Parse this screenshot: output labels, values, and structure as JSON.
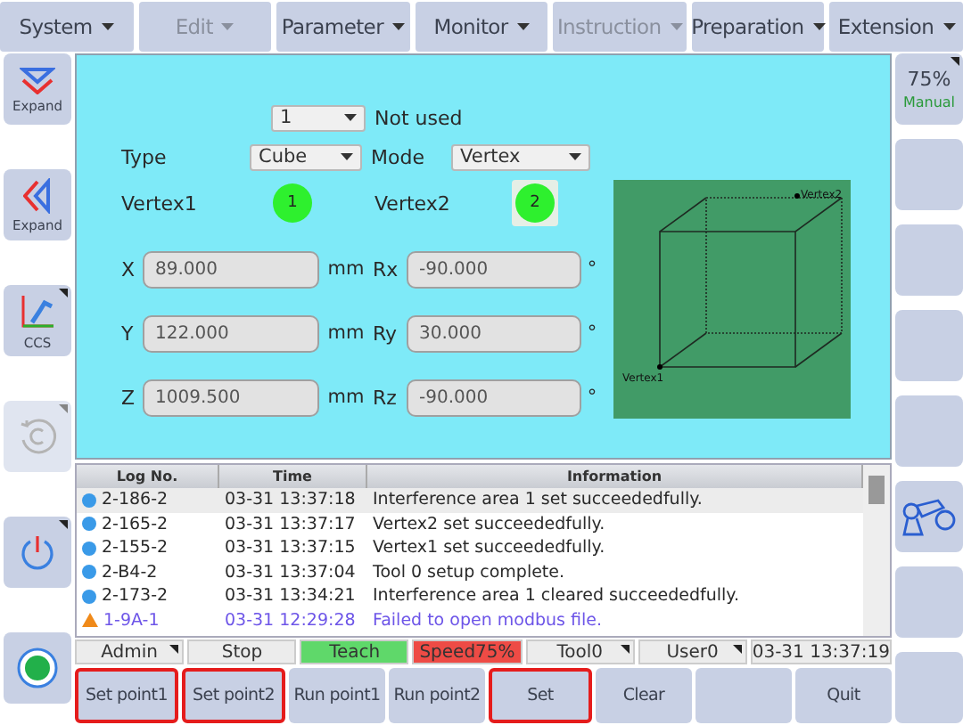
{
  "menu": [
    {
      "label": "System",
      "disabled": false
    },
    {
      "label": "Edit",
      "disabled": true
    },
    {
      "label": "Parameter",
      "disabled": false
    },
    {
      "label": "Monitor",
      "disabled": false
    },
    {
      "label": "Instruction",
      "disabled": true
    },
    {
      "label": "Preparation",
      "disabled": false
    },
    {
      "label": "Extension",
      "disabled": false
    }
  ],
  "left_buttons": [
    {
      "kind": "expand_down",
      "label": "Expand",
      "has_menu": false,
      "disabled": false
    },
    {
      "kind": "expand_left",
      "label": "Expand",
      "has_menu": false,
      "disabled": false
    },
    {
      "kind": "ccs",
      "label": "CCS",
      "has_menu": true,
      "disabled": false
    },
    {
      "kind": "rotate",
      "has_menu": true,
      "disabled": true
    },
    {
      "kind": "power",
      "has_menu": true,
      "disabled": false
    },
    {
      "kind": "record",
      "has_menu": false,
      "disabled": false
    }
  ],
  "right_buttons": [
    {
      "kind": "speed",
      "value": "75%",
      "mode": "Manual",
      "has_menu": true
    },
    {
      "kind": "blank"
    },
    {
      "kind": "blank"
    },
    {
      "kind": "blank"
    },
    {
      "kind": "blank"
    },
    {
      "kind": "robot"
    },
    {
      "kind": "blank"
    },
    {
      "kind": "blank"
    }
  ],
  "area": {
    "index": "1",
    "status": "Not used",
    "type_label": "Type",
    "type": "Cube",
    "mode_label": "Mode",
    "mode": "Vertex",
    "vertices": [
      {
        "label": "Vertex1",
        "number": "1",
        "selected": false
      },
      {
        "label": "Vertex2",
        "number": "2",
        "selected": true
      }
    ],
    "coords": [
      {
        "label": "X",
        "value": "89.000",
        "unit": "mm",
        "rot_label": "Rx",
        "rot_value": "-90.000",
        "rot_unit": "°"
      },
      {
        "label": "Y",
        "value": "122.000",
        "unit": "mm",
        "rot_label": "Ry",
        "rot_value": "30.000",
        "rot_unit": "°"
      },
      {
        "label": "Z",
        "value": "1009.500",
        "unit": "mm",
        "rot_label": "Rz",
        "rot_value": "-90.000",
        "rot_unit": "°"
      }
    ],
    "diagram": {
      "top_label": "Vertex2",
      "bottom_label": "Vertex1"
    }
  },
  "log": {
    "columns": [
      "Log No.",
      "Time",
      "Information"
    ],
    "rows": [
      {
        "kind": "info",
        "no": "2-186-2",
        "time": "03-31 13:37:18",
        "info": "Interference area 1 set succeededfully.",
        "selected": true
      },
      {
        "kind": "info",
        "no": "2-165-2",
        "time": "03-31 13:37:17",
        "info": "Vertex2 set succeededfully.",
        "selected": false
      },
      {
        "kind": "info",
        "no": "2-155-2",
        "time": "03-31 13:37:15",
        "info": "Vertex1 set succeededfully.",
        "selected": false
      },
      {
        "kind": "info",
        "no": "2-B4-2",
        "time": "03-31 13:37:04",
        "info": "Tool 0 setup complete.",
        "selected": false
      },
      {
        "kind": "info",
        "no": "2-173-2",
        "time": "03-31 13:34:21",
        "info": "Interference area 1  cleared succeededfully.",
        "selected": false
      },
      {
        "kind": "warning",
        "no": "1-9A-1",
        "time": "03-31 12:29:28",
        "info": "Failed to open modbus file.",
        "selected": false
      }
    ]
  },
  "status_bar": [
    {
      "label": "Admin",
      "color": "#ececec",
      "has_menu": true
    },
    {
      "label": "Stop",
      "color": "#ececec",
      "has_menu": false
    },
    {
      "label": "Teach",
      "color": "#5fd86a",
      "has_menu": false
    },
    {
      "label": "Speed75%",
      "color": "#ee4b45",
      "has_menu": false
    },
    {
      "label": "Tool0",
      "color": "#ececec",
      "has_menu": true
    },
    {
      "label": "User0",
      "color": "#ececec",
      "has_menu": true
    },
    {
      "label": "03-31 13:37:19",
      "color": "#ececec",
      "has_menu": false
    }
  ],
  "bottom_buttons": [
    {
      "label": "Set point1",
      "highlighted": true
    },
    {
      "label": "Set point2",
      "highlighted": true
    },
    {
      "label": "Run point1",
      "highlighted": false
    },
    {
      "label": "Run point2",
      "highlighted": false
    },
    {
      "label": "Set",
      "highlighted": true
    },
    {
      "label": "Clear",
      "highlighted": false
    },
    {
      "highlighted": false
    },
    {
      "label": "Quit",
      "highlighted": false
    }
  ]
}
